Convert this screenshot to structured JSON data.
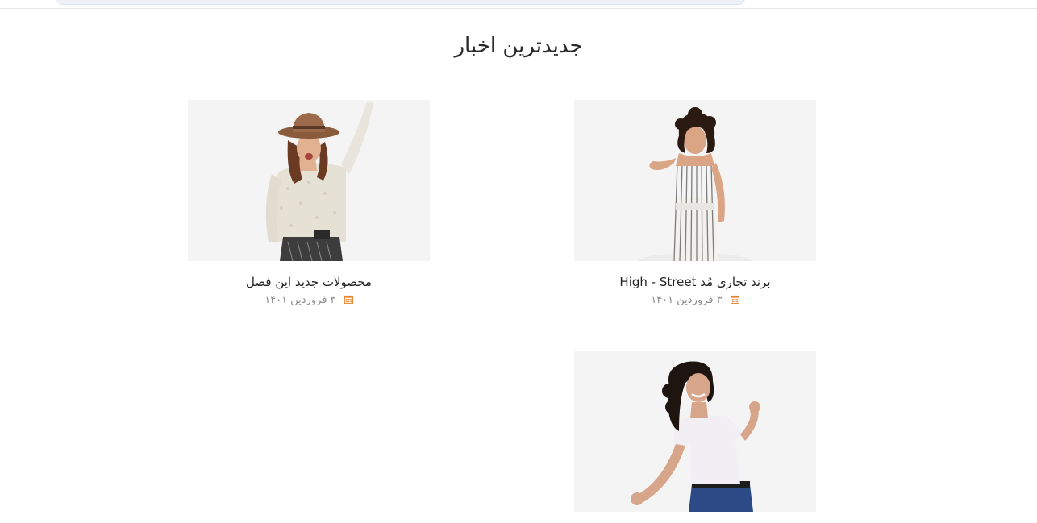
{
  "section": {
    "title": "جدیدترین اخبار"
  },
  "news": [
    {
      "title": "برند تجاری مُد High - Street",
      "date": "۳ فروردین ۱۴۰۱",
      "date_icon": "calendar-icon",
      "image": "woman in striped jumpsuit"
    },
    {
      "title": "محصولات جدید این فصل",
      "date": "۳ فروردین ۱۴۰۱",
      "date_icon": "calendar-icon",
      "image": "woman with hat waving"
    },
    {
      "title": "",
      "date": "",
      "image": "smiling woman in white t-shirt"
    }
  ],
  "colors": {
    "accent": "#e8852e",
    "title": "#2a2a2a",
    "muted": "#8c8c8c",
    "image_bg": "#f5f5f5"
  }
}
